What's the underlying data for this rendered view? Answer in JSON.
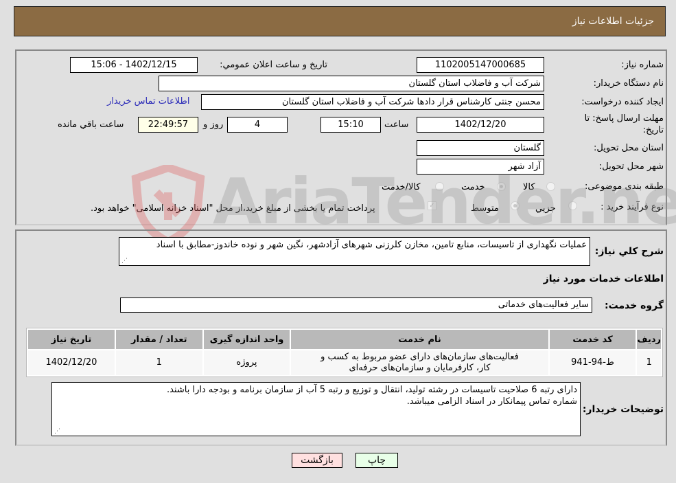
{
  "header": {
    "title": "جزئیات اطلاعات نیاز"
  },
  "fields": {
    "need_number_label": "شماره نیاز:",
    "need_number": "1102005147000685",
    "announce_label": "تاریخ و ساعت اعلان عمومي:",
    "announce_value": "1402/12/15 - 15:06",
    "buyer_org_label": "نام دستگاه خریدار:",
    "buyer_org": "شرکت آب و فاضلاب استان گلستان",
    "creator_label": "ایجاد کننده درخواست:",
    "creator": "محسن جنتی کارشناس قرار دادها شرکت آب و فاضلاب استان گلستان",
    "contact_link": "اطلاعات تماس خریدار",
    "deadline_label_line1": "مهلت ارسال پاسخ: تا",
    "deadline_label_line2": "تاریخ:",
    "deadline_date": "1402/12/20",
    "time_label": "ساعت",
    "deadline_time": "15:10",
    "days_value": "4",
    "days_label": "روز و",
    "remaining_time": "22:49:57",
    "remaining_label": "ساعت باقي مانده",
    "province_label": "استان محل تحویل:",
    "province": "گلستان",
    "city_label": "شهر محل تحویل:",
    "city": "آزاد شهر",
    "category_label": "طبقه بندی موضوعی:",
    "category_options": [
      "کالا",
      "خدمت",
      "کالا/خدمت"
    ],
    "category_selected": "خدمت",
    "process_label": "نوع فرآیند خرید :",
    "process_options": [
      "جزيي",
      "متوسط"
    ],
    "process_selected": "متوسط",
    "treasury_note": "پرداخت تمام یا بخشی از مبلغ خرید،از محل \"اسناد خزانه اسلامی\" خواهد بود.",
    "treasury_checked": true
  },
  "summary": {
    "label": "شرح کلي نیاز:",
    "text": "عملیات نگهداری از تاسیسات، منابع تامین، مخازن کلرزنی شهرهای آزادشهر، نگین شهر و نوده خاندوز-مطابق با اسناد"
  },
  "services": {
    "section_title": "اطلاعات خدمات مورد نیاز",
    "group_label": "گروه خدمت:",
    "group_value": "سایر فعالیت‌های خدماتی",
    "columns": [
      "ردیف",
      "کد خدمت",
      "نام خدمت",
      "واحد اندازه گیری",
      "تعداد / مقدار",
      "تاریخ نیاز"
    ],
    "rows": [
      {
        "index": "1",
        "code": "ط-94-941",
        "name": "فعالیت‌های سازمان‌های دارای عضو مربوط به کسب و کار، کارفرمایان و سازمان‌های حرفه‌ای",
        "unit": "پروژه",
        "quantity": "1",
        "date": "1402/12/20"
      }
    ]
  },
  "buyer_notes": {
    "label": "توضیحات خریدار:",
    "line1": "دارای رتبه 6 صلاحیت تاسیسات در رشته تولید، انتقال و توزیع و رتبه 5 آب از سازمان برنامه و بودجه دارا باشند.",
    "line2": "شماره تماس پیمانکار در اسناد الزامی میباشد."
  },
  "buttons": {
    "print": "چاپ",
    "back": "بازگشت"
  },
  "watermark": {
    "text": "AriaTender.neT"
  }
}
